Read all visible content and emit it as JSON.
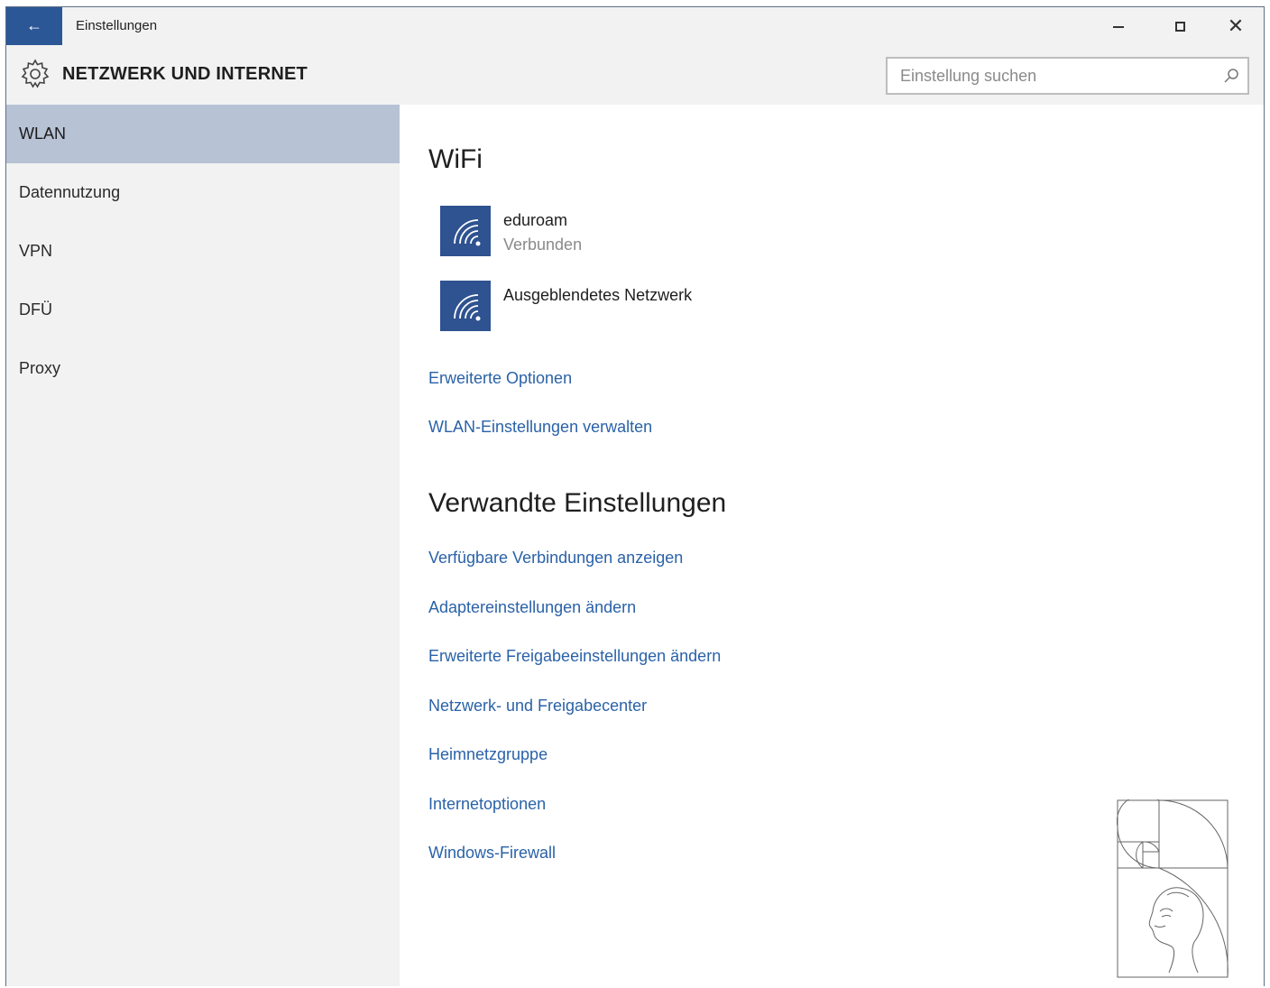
{
  "window": {
    "app_title": "Einstellungen",
    "back_icon": "arrow-left-icon",
    "controls": {
      "minimize_icon": "minimize-icon",
      "maximize_icon": "maximize-icon",
      "close_icon": "close-icon"
    }
  },
  "header": {
    "icon": "gear-icon",
    "title": "NETZWERK UND INTERNET",
    "search": {
      "placeholder": "Einstellung suchen",
      "value": "",
      "icon": "search-icon"
    }
  },
  "sidebar": {
    "items": [
      {
        "label": "WLAN",
        "active": true
      },
      {
        "label": "Datennutzung",
        "active": false
      },
      {
        "label": "VPN",
        "active": false
      },
      {
        "label": "DFÜ",
        "active": false
      },
      {
        "label": "Proxy",
        "active": false
      }
    ]
  },
  "main": {
    "wifi_heading": "WiFi",
    "networks": [
      {
        "name": "eduroam",
        "status": "Verbunden",
        "icon": "wifi-icon"
      },
      {
        "name": "Ausgeblendetes Netzwerk",
        "status": "",
        "icon": "wifi-icon"
      }
    ],
    "wifi_links": [
      "Erweiterte Optionen",
      "WLAN-Einstellungen verwalten"
    ],
    "related_heading": "Verwandte Einstellungen",
    "related_links": [
      "Verfügbare Verbindungen anzeigen",
      "Adaptereinstellungen ändern",
      "Erweiterte Freigabeeinstellungen ändern",
      "Netzwerk- und Freigabecenter",
      "Heimnetzgruppe",
      "Internetoptionen",
      "Windows-Firewall"
    ],
    "logo_icon": "golden-spiral-portrait-logo"
  },
  "colors": {
    "accent": "#2b5797",
    "tile": "#2f5290",
    "link": "#2a62a8",
    "active_nav": "#b7c2d4",
    "panel_bg": "#f2f2f2"
  }
}
